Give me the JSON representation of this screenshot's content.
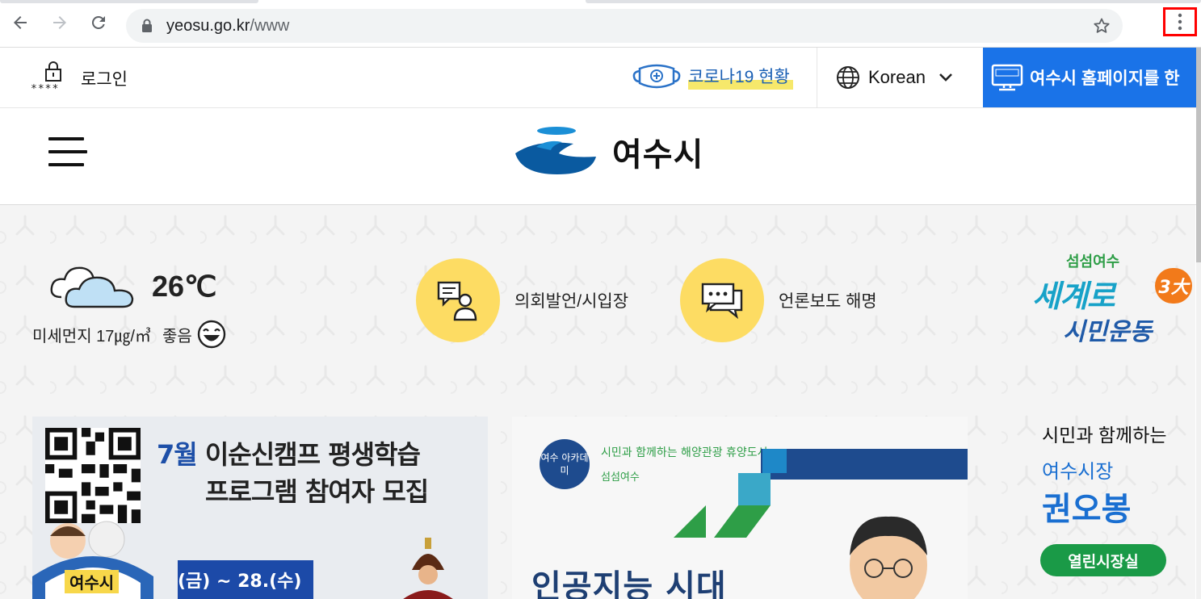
{
  "browser": {
    "url_host": "yeosu.go.kr",
    "url_path": "/www"
  },
  "topbar": {
    "login_stars": "****",
    "login_label": "로그인",
    "covid_label": "코로나19 현황",
    "language_label": "Korean",
    "banner_label": "여수시 홈페이지를 한"
  },
  "header": {
    "logo_text": "여수시"
  },
  "weather": {
    "temperature": "26℃",
    "dust_label": "미세먼지 17㎍/㎥",
    "dust_grade": "좋음"
  },
  "quick_links": [
    {
      "label": "의회발언/시입장"
    },
    {
      "label": "언론보도 해명"
    }
  ],
  "campaign": {
    "line1": "섬섬여수",
    "line2": "세계로",
    "badge": "3大",
    "line3": "시민운동"
  },
  "banner1": {
    "title_accent": "7월",
    "title_rest": " 이순신캠프 평생학습",
    "title_line2": "프로그램 참여자 모집",
    "city_label": "여수시",
    "date_text": "(금) ~ 28.(수)"
  },
  "banner2": {
    "badge": "여수 아카데미",
    "slogan": "시민과 함께하는 해양관광 휴양도시",
    "slogan2": "섬섬여수",
    "headline": "인공지능 시대"
  },
  "mayor": {
    "line1": "시민과 함께하는",
    "line2": "여수시장",
    "name": "권오봉",
    "button": "열린시장실"
  },
  "colors": {
    "brand_blue": "#1a73e8",
    "quick_yellow": "#fddc63",
    "mayor_green": "#1a9a47"
  }
}
